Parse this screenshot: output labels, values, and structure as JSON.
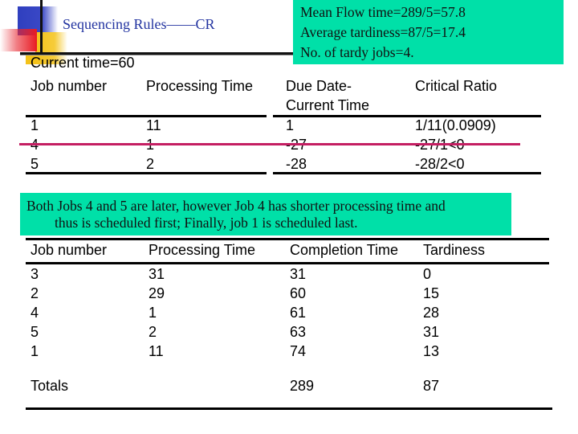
{
  "slide": {
    "title": "Sequencing Rules——CR",
    "current_time": "Current time=60"
  },
  "summary": {
    "lines": [
      "Mean Flow time=289/5=57.8",
      "Average tardiness=87/5=17.4",
      "No. of tardy jobs=4."
    ]
  },
  "cr_table": {
    "headers": [
      "Job number",
      "Processing Time",
      "Due Date-",
      "Current Time",
      "Critical Ratio"
    ],
    "rows": [
      {
        "job": "1",
        "processing": "11",
        "slack": "1",
        "cr": "1/11(0.0909)"
      },
      {
        "job": "4",
        "processing": "1",
        "slack": "-27",
        "cr": "-27/1<0"
      },
      {
        "job": "5",
        "processing": "2",
        "slack": "-28",
        "cr": "-28/2<0"
      }
    ],
    "strike_color": "#c41e62"
  },
  "note": {
    "line1": "Both Jobs 4 and 5 are later, however Job 4 has shorter processing time and",
    "line2": "thus is scheduled first; Finally, job 1 is scheduled last."
  },
  "schedule_table": {
    "headers": [
      "Job number",
      "Processing Time",
      "Completion Time",
      "Tardiness"
    ],
    "rows": [
      {
        "job": "3",
        "processing": "31",
        "completion": "31",
        "tardiness": "0"
      },
      {
        "job": "2",
        "processing": "29",
        "completion": "60",
        "tardiness": "15"
      },
      {
        "job": "4",
        "processing": "1",
        "completion": "61",
        "tardiness": "28"
      },
      {
        "job": "5",
        "processing": "2",
        "completion": "63",
        "tardiness": "31"
      },
      {
        "job": "1",
        "processing": "11",
        "completion": "74",
        "tardiness": "13"
      }
    ],
    "totals": {
      "label": "Totals",
      "completion": "289",
      "tardiness": "87"
    }
  },
  "colors": {
    "highlight_green": "#00e0a8",
    "title_blue": "#2233a0"
  }
}
